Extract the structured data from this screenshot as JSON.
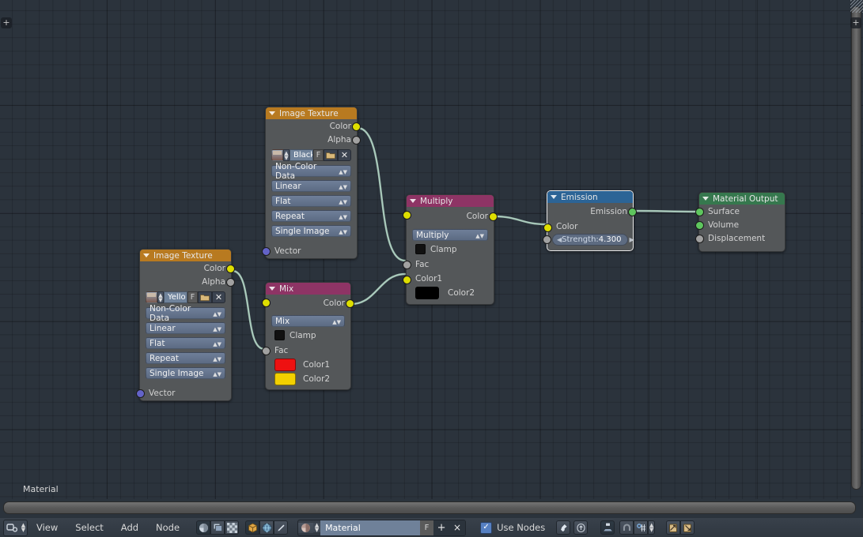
{
  "editor": {
    "type": "node-editor",
    "canvas_label": "Material",
    "grid_color": "#2b333c"
  },
  "nodes": [
    {
      "id": "image-texture-top",
      "title": "Image Texture",
      "header_color": "#b87a20",
      "outputs": [
        "Color",
        "Alpha"
      ],
      "image_name": "Black",
      "fake_user": "F",
      "dropdowns": [
        "Non-Color Data",
        "Linear",
        "Flat",
        "Repeat",
        "Single Image"
      ],
      "inputs": [
        "Vector"
      ]
    },
    {
      "id": "image-texture-bottom",
      "title": "Image Texture",
      "header_color": "#b87a20",
      "outputs": [
        "Color",
        "Alpha"
      ],
      "image_name": "Yello",
      "fake_user": "F",
      "dropdowns": [
        "Non-Color Data",
        "Linear",
        "Flat",
        "Repeat",
        "Single Image"
      ],
      "inputs": [
        "Vector"
      ]
    },
    {
      "id": "mix-node",
      "title": "Mix",
      "header_color": "#8e3465",
      "outputs": [
        "Color"
      ],
      "blend_mode": "Mix",
      "clamp_label": "Clamp",
      "inputs": [
        "Fac",
        "Color1",
        "Color2"
      ],
      "color1": "#ee1111",
      "color2": "#f2d000"
    },
    {
      "id": "multiply-node",
      "title": "Multiply",
      "header_color": "#8e3465",
      "outputs": [
        "Color"
      ],
      "blend_mode": "Multiply",
      "clamp_label": "Clamp",
      "inputs": [
        "Fac",
        "Color1",
        "Color2"
      ],
      "color2": "#000000"
    },
    {
      "id": "emission-node",
      "title": "Emission",
      "header_color": "#2c6496",
      "outputs": [
        "Emission"
      ],
      "inputs": [
        "Color"
      ],
      "strength_label": "Strength:",
      "strength_value": "4.300"
    },
    {
      "id": "material-output-node",
      "title": "Material Output",
      "header_color": "#36784e",
      "inputs": [
        "Surface",
        "Volume",
        "Displacement"
      ]
    }
  ],
  "toolbar": {
    "menus": [
      "View",
      "Select",
      "Add",
      "Node"
    ],
    "shader_type_icons": [
      "sphere-shading-icon",
      "image-layers-icon",
      "checker-texture-icon"
    ],
    "context_icons": [
      "object-cube-icon",
      "world-globe-icon",
      "brush-pen-icon"
    ],
    "material_field": {
      "icon": "material-sphere-icon",
      "name": "Material",
      "fake_user": "F",
      "add_label": "+",
      "remove_label": "×"
    },
    "use_nodes": {
      "label": "Use Nodes",
      "checked": true,
      "check_glyph": "✓"
    },
    "right_icons": [
      "pin-icon",
      "go-to-parent-icon",
      "snap-node-icon",
      "magnet-icon",
      "snap-target-icon",
      "paste-in-icon",
      "copy-out-icon"
    ]
  },
  "sockets": {
    "color_yellow": "#dede00",
    "value_grey": "#a1a1a1",
    "shader_green": "#5ec65e",
    "vector_purple": "#6363c8",
    "link_color": "#9dbcae"
  }
}
